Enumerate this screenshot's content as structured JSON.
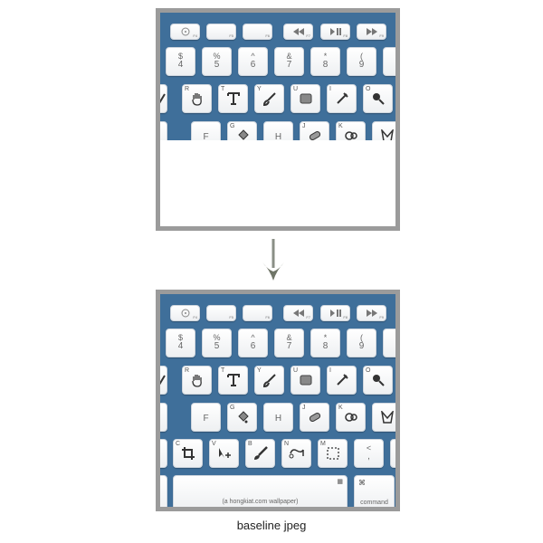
{
  "caption": "baseline jpeg",
  "keyboard": {
    "fn_row": [
      "F4",
      "F5",
      "F6",
      "F7",
      "F8",
      "F9"
    ],
    "number_row": [
      {
        "top": "$",
        "bottom": "4"
      },
      {
        "top": "%",
        "bottom": "5"
      },
      {
        "top": "^",
        "bottom": "6"
      },
      {
        "top": "&",
        "bottom": "7"
      },
      {
        "top": "*",
        "bottom": "8"
      },
      {
        "top": "(",
        "bottom": "9"
      }
    ],
    "qwerty_row": [
      "R",
      "T",
      "Y",
      "U",
      "I",
      "O"
    ],
    "home_row": [
      "F",
      "G",
      "H",
      "J",
      "K"
    ],
    "bottom_row": [
      "C",
      "V",
      "B",
      "N",
      "M",
      "<"
    ],
    "home_f_label": "F",
    "home_h_label": "H",
    "comma_top": "<",
    "comma_bottom": ",",
    "space_label": "(a hongkiat.com wallpaper)",
    "command_label": "command",
    "command_symbol": "⌘"
  },
  "colors": {
    "keyboard_bg": "#3f6f9a",
    "frame": "#9b9b9b",
    "key": "#f4f5f6"
  }
}
